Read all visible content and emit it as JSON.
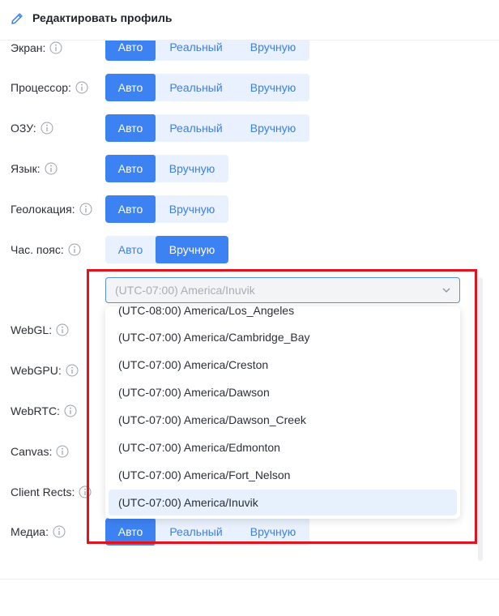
{
  "header": {
    "title": "Редактировать профиль",
    "icon": "pencil-icon"
  },
  "rows": {
    "screen": {
      "label": "Экран:",
      "options": [
        "Авто",
        "Реальный",
        "Вручную"
      ],
      "active": 0
    },
    "cpu": {
      "label": "Процессор:",
      "options": [
        "Авто",
        "Реальный",
        "Вручную"
      ],
      "active": 0
    },
    "ram": {
      "label": "ОЗУ:",
      "options": [
        "Авто",
        "Реальный",
        "Вручную"
      ],
      "active": 0
    },
    "lang": {
      "label": "Язык:",
      "options": [
        "Авто",
        "Вручную"
      ],
      "active": 0
    },
    "geo": {
      "label": "Геолокация:",
      "options": [
        "Авто",
        "Вручную"
      ],
      "active": 0
    },
    "tz": {
      "label": "Час. пояс:",
      "options": [
        "Авто",
        "Вручную"
      ],
      "active": 1
    },
    "webgl": {
      "label": "WebGL:"
    },
    "webgpu": {
      "label": "WebGPU:"
    },
    "webrtc": {
      "label": "WebRTC:"
    },
    "canvas": {
      "label": "Canvas:"
    },
    "rects": {
      "label": "Client Rects:"
    },
    "media": {
      "label": "Медиа:",
      "options": [
        "Авто",
        "Реальный",
        "Вручную"
      ],
      "active": 0
    }
  },
  "timezone": {
    "selected": "(UTC-07:00) America/Inuvik",
    "options": [
      "(UTC-08:00) America/Los_Angeles",
      "(UTC-07:00) America/Cambridge_Bay",
      "(UTC-07:00) America/Creston",
      "(UTC-07:00) America/Dawson",
      "(UTC-07:00) America/Dawson_Creek",
      "(UTC-07:00) America/Edmonton",
      "(UTC-07:00) America/Fort_Nelson",
      "(UTC-07:00) America/Inuvik"
    ]
  },
  "colors": {
    "accent": "#3d82f2",
    "accent_light": "#e8f1fd",
    "highlight": "#e3131b"
  }
}
